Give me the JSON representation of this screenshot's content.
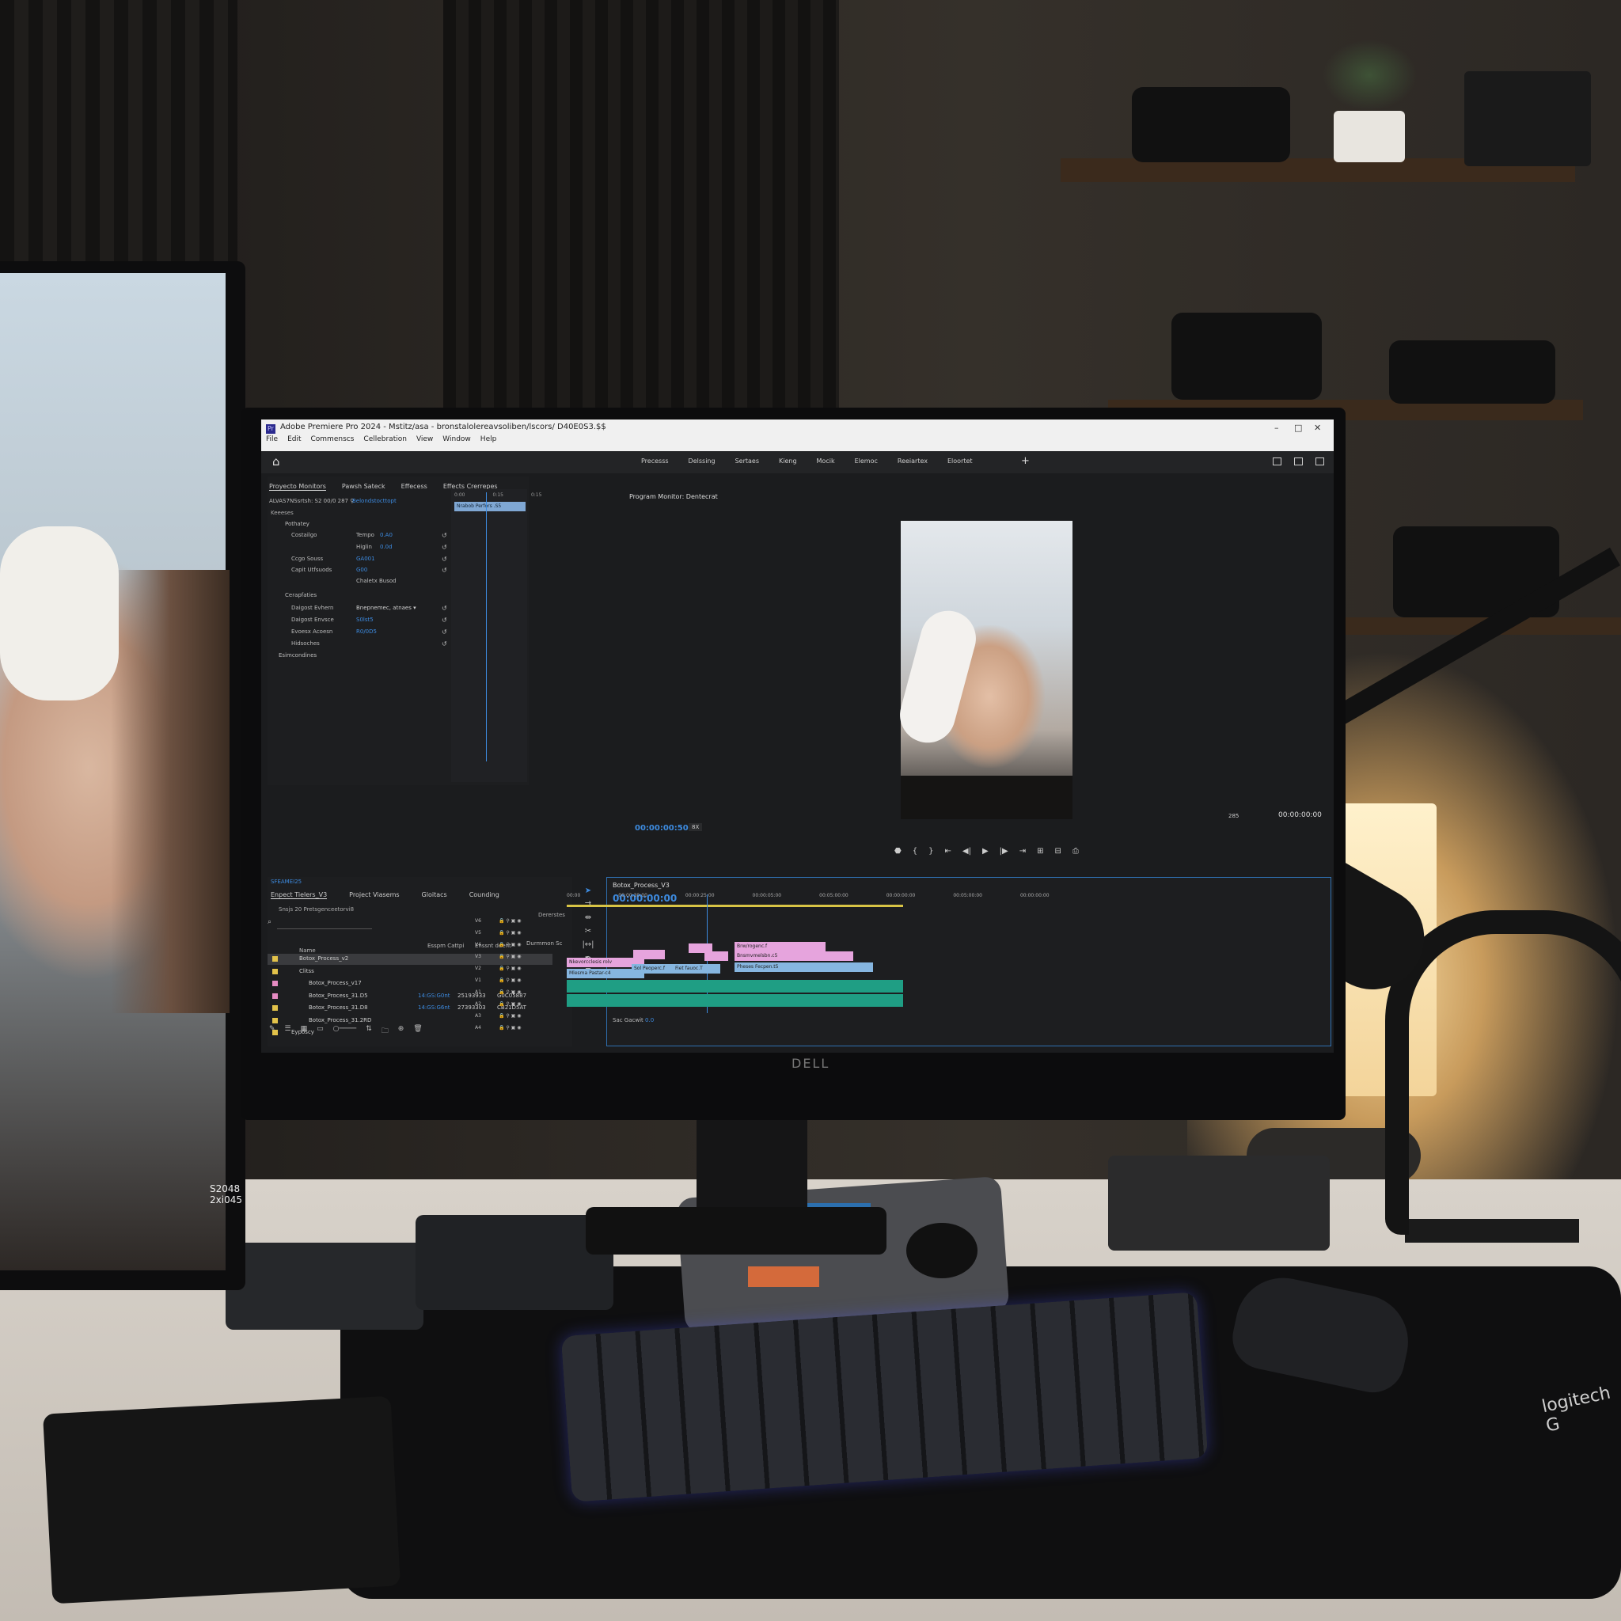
{
  "window": {
    "title": "Adobe Premiere Pro 2024 - Mstitz/asa - bronstalolereavsoliben/lscors/ D40E0S3.$$",
    "app_badge": "Pr",
    "menu": [
      "File",
      "Edit",
      "Commenscs",
      "Cellebration",
      "View",
      "Window",
      "Help"
    ],
    "controls": [
      "–",
      "□",
      "✕"
    ]
  },
  "workspaces": {
    "items": [
      "Precesss",
      "Delssing",
      "Sertaes",
      "Kieng",
      "Mocik",
      "Elemoc",
      "Reeiartex",
      "Eloortet"
    ],
    "add": "+"
  },
  "effect_controls": {
    "tabs": [
      "Proyecto Monitors",
      "Pawsh Sateck",
      "Effecess",
      "Effects Crerrepes"
    ],
    "clip_label": "ALVAS7NSsrtsh: S2 00/0 287 ⚲",
    "clip_link": "Belondstocttopt",
    "section": "Keeeses",
    "rows": [
      {
        "label": "Pothatey",
        "value": ""
      },
      {
        "label": "Costailgo",
        "value": ""
      },
      {
        "label": "Tempo",
        "value": "0.A0"
      },
      {
        "label": "Higlin",
        "value": "0.0d"
      },
      {
        "label": "Ccgo Souss",
        "value": "GA001"
      },
      {
        "label": "Capit Utfsuods",
        "value": "G00"
      },
      {
        "label": "Chaletx Busod",
        "value": ""
      },
      {
        "label": "Cerapfaties",
        "value": ""
      },
      {
        "label": "Daigost Evhern",
        "value": "Bnepnemec, atnaes ▾"
      },
      {
        "label": "Daigost Envsce",
        "value": "S0lst5"
      },
      {
        "label": "Evoesx Acoesn",
        "value": "R0/0D5"
      },
      {
        "label": "Hidsoches",
        "value": ""
      },
      {
        "label": "Esimcondines",
        "value": ""
      }
    ],
    "timeline_ticks": [
      "0:00",
      "0:15",
      "0:15"
    ],
    "clip_bar": "Nrabob Perfors .S5"
  },
  "program_monitor": {
    "title": "Program Monitor: Dentecrat",
    "timecode": "00:00:00:50",
    "fit": "8X",
    "resolution": "285",
    "duration": "00:00:00:00"
  },
  "project": {
    "sequence_label": "SFEAMEI25",
    "tabs": [
      "Enpect Tielers_V3",
      "Project Viasems",
      "Gloitacs",
      "Counding"
    ],
    "path": "Snsjs 20 Pretsgenceetorvi8",
    "count": "Dererstes",
    "columns": [
      "Name",
      "Esspm Cattpi",
      "Enssnt deent",
      "Durmmon Sc"
    ],
    "rows": [
      {
        "name": "Botox_Process_v2",
        "a": "",
        "b": "",
        "c": "",
        "color": "#e2c24a"
      },
      {
        "name": "Clitss",
        "a": "",
        "b": "",
        "c": "",
        "color": "#e2c24a"
      },
      {
        "name": "Botox_Process_v17",
        "a": "",
        "b": "",
        "c": "",
        "color": "#e58bc2"
      },
      {
        "name": "Botox_Process_31.D5",
        "a": "14:GS:G0nt",
        "b": "25193933",
        "c": "G0C05887",
        "color": "#e58bc2"
      },
      {
        "name": "Botox_Process_31.D8",
        "a": "14:GS:G6nt",
        "b": "27393303",
        "c": "CB21D5AT",
        "color": "#e2c24a"
      },
      {
        "name": "Botox_Process_31.2RD",
        "a": "",
        "b": "",
        "c": "",
        "color": "#e2c24a"
      },
      {
        "name": "Eyposcy",
        "a": "",
        "b": "",
        "c": "",
        "color": "#e2c24a"
      }
    ]
  },
  "timeline": {
    "sequence": "Botox_Process_V3",
    "timecode": "00:00:00:00",
    "ruler": [
      "00:00",
      "00:00:30:00",
      "00:00:25:00",
      "00:00:05:00",
      "00:05:00:00",
      "00:00:00:00",
      "00:05:00:00",
      "00:00:00:00"
    ],
    "tracks": [
      "V6",
      "V5",
      "V4",
      "V3",
      "V2",
      "V1",
      "A1",
      "A2",
      "A3",
      "A4"
    ],
    "clips": [
      {
        "label": "Brw/rogenc.f",
        "color": "#e6a4dd"
      },
      {
        "label": "Bnsmvmelsbn.c5",
        "color": "#e6a4dd"
      },
      {
        "label": "Nkevorcclesis rolv",
        "color": "#e6a4dd"
      },
      {
        "label": "Mlesma Pastar-c4",
        "color": "#86b6e0"
      },
      {
        "label": "Sol Peoperc.f",
        "color": "#86b6e0"
      },
      {
        "label": "Fiet fauoc.T",
        "color": "#86b6e0"
      },
      {
        "label": "Pheses Fecpen.t5",
        "color": "#86b6e0"
      }
    ],
    "master": "Sac Gacwit",
    "master_val": "0.0"
  },
  "left_monitor_text": "S2048 2xi045",
  "monitor_brand": "DELL",
  "mat_brand": "logitech G"
}
